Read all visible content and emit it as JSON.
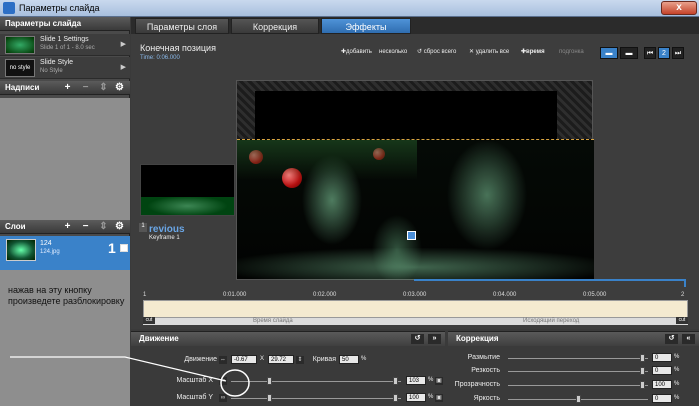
{
  "window": {
    "title": "Параметры слайда",
    "close_label": "x"
  },
  "left_panel": {
    "slide_params_header": "Параметры слайда",
    "slide_settings": {
      "title": "Slide 1 Settings",
      "subtitle": "Slide 1 of 1 - 8.0 sec"
    },
    "slide_style": {
      "title": "Slide Style",
      "subtitle": "No Style",
      "thumb_text": "no style"
    },
    "captions_header": "Надписи",
    "layers_header": "Слои",
    "layer": {
      "name": "124",
      "file": "124.jpg",
      "index": "1"
    },
    "annotation": "нажав на эту кнопку произведете разблокировку"
  },
  "tabs": [
    {
      "label": "Параметры слоя",
      "active": false
    },
    {
      "label": "Коррекция",
      "active": false
    },
    {
      "label": "Эффекты",
      "active": true
    }
  ],
  "main": {
    "title": "Конечная позиция",
    "time": "Time: 0:06.000",
    "toolbar": {
      "add_label": "добавить",
      "several_label": "несколько",
      "reset_label": "сброс всего",
      "delete_label": "удалить все",
      "time_label": "время",
      "split_label": "подгонка"
    },
    "nav_badge": "2",
    "previous_label": "revious",
    "keyframe_label": "Keyframe 1",
    "previous_num": "1"
  },
  "timeline": {
    "ticks": [
      "0:00",
      "0:01.000",
      "0:02.000",
      "0:03.000",
      "0:04.000",
      "0:05.000"
    ],
    "left_marker": "1",
    "right_marker": "2",
    "slide_time_label": "Время слайда",
    "transition_label": "Исходящий переход",
    "cut_label": "cut"
  },
  "motion": {
    "header": "Движение",
    "movement_label": "Движение",
    "x_value": "-0.67",
    "x_sep": "X",
    "y_value": "29.72",
    "curve_label": "Кривая",
    "curve_value": "50",
    "scale_x_label": "Масштаб X",
    "scale_x_value": "103",
    "scale_y_label": "Масштаб Y",
    "scale_y_value": "100",
    "pct": "%"
  },
  "correction": {
    "header": "Коррекция",
    "rows": [
      {
        "label": "Размытие",
        "value": "0"
      },
      {
        "label": "Резкость",
        "value": "0"
      },
      {
        "label": "Прозрачность",
        "value": "100"
      },
      {
        "label": "Яркость",
        "value": "0"
      }
    ],
    "pct": "%"
  },
  "colors": {
    "accent": "#3a82c9",
    "panel": "#3a3a3a",
    "track": "#f4ead0"
  },
  "icons": [
    "app-icon",
    "close-icon",
    "add-icon",
    "remove-icon",
    "settings-icon",
    "undo-icon",
    "forward-icon",
    "link-icon",
    "lock-icon"
  ]
}
